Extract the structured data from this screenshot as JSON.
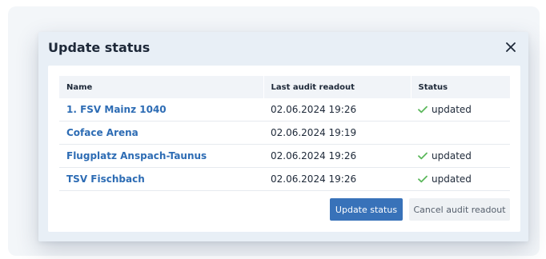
{
  "dialog": {
    "title": "Update status",
    "close_icon": "close-icon"
  },
  "table": {
    "headers": {
      "name": "Name",
      "last_audit": "Last audit readout",
      "status": "Status"
    },
    "rows": [
      {
        "name": "1. FSV Mainz 1040",
        "last_audit": "02.06.2024 19:26",
        "status": "updated",
        "status_icon": "checkmark-icon"
      },
      {
        "name": "Coface Arena",
        "last_audit": "02.06.2024 19:19",
        "status": "",
        "status_icon": ""
      },
      {
        "name": "Flugplatz Anspach-Taunus",
        "last_audit": "02.06.2024 19:26",
        "status": "updated",
        "status_icon": "checkmark-icon"
      },
      {
        "name": "TSV Fischbach",
        "last_audit": "02.06.2024 19:26",
        "status": "updated",
        "status_icon": "checkmark-icon"
      }
    ]
  },
  "buttons": {
    "update_label": "Update status",
    "cancel_label": "Cancel audit readout"
  },
  "colors": {
    "link": "#2d6cb4",
    "primary_button": "#3872b9",
    "success_check": "#5cb85c",
    "dialog_background": "#e8eff6"
  }
}
